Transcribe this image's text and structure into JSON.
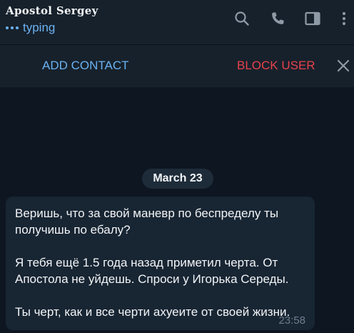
{
  "header": {
    "title": "Apostol Sergey",
    "status": "typing",
    "icons": [
      "search-icon",
      "phone-icon",
      "sidebar-toggle-icon",
      "more-vertical-icon"
    ]
  },
  "actionbar": {
    "add_contact": "ADD CONTACT",
    "block_user": "BLOCK USER",
    "close_icon": "close-icon"
  },
  "chat": {
    "date": "March 23",
    "message": {
      "paragraphs": [
        "Веришь, что за свой маневр по беспределу ты получишь по ебалу?",
        "Я тебя ещё 1.5 года назад приметил черта. От Апостола не уйдешь. Спроси у Игорька Середы.",
        "Ты черт, как и все черти ахуеите от своей жизни."
      ],
      "time": "23:58"
    }
  },
  "colors": {
    "background": "#0e1621",
    "header": "#17212b",
    "accent": "#6ab2f2",
    "danger": "#e5424d",
    "bubble": "#182533"
  }
}
